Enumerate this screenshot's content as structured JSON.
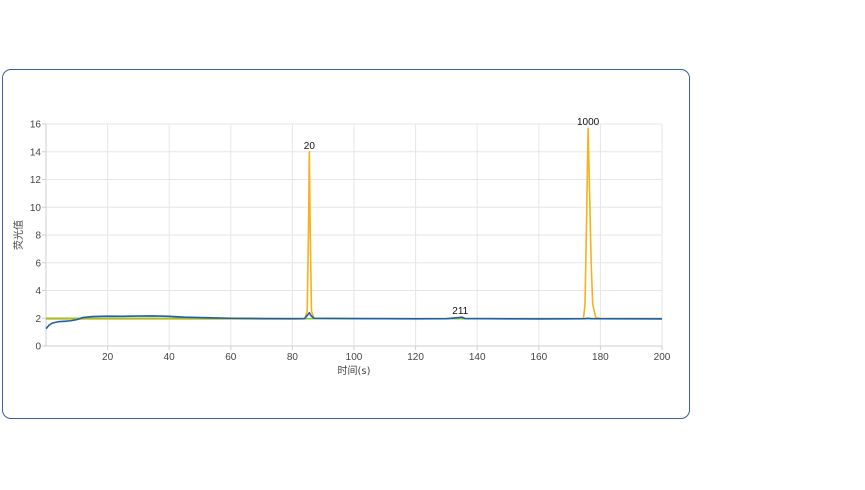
{
  "chart_data": {
    "type": "line",
    "xlabel": "时间(s)",
    "ylabel": "荧光值",
    "xlim": [
      0,
      200
    ],
    "ylim": [
      0,
      16
    ],
    "xticks": [
      20,
      40,
      60,
      80,
      100,
      120,
      140,
      160,
      180,
      200
    ],
    "yticks": [
      0,
      2,
      4,
      6,
      8,
      10,
      12,
      14,
      16
    ],
    "grid": true,
    "series": [
      {
        "color": "#f5b21c",
        "points": [
          [
            0,
            1.95
          ],
          [
            20,
            1.95
          ],
          [
            40,
            1.95
          ],
          [
            60,
            1.95
          ],
          [
            80,
            1.95
          ],
          [
            84,
            1.96
          ],
          [
            84.8,
            2.5
          ],
          [
            85.2,
            8.0
          ],
          [
            85.5,
            14.0
          ],
          [
            85.8,
            8.0
          ],
          [
            86.2,
            2.5
          ],
          [
            87,
            1.97
          ],
          [
            100,
            1.97
          ],
          [
            120,
            1.97
          ],
          [
            140,
            1.97
          ],
          [
            160,
            1.97
          ],
          [
            174.5,
            1.98
          ],
          [
            175,
            3.0
          ],
          [
            175.5,
            9.0
          ],
          [
            176,
            15.7
          ],
          [
            176.5,
            11.0
          ],
          [
            177,
            6.0
          ],
          [
            177.5,
            3.0
          ],
          [
            178.5,
            2.05
          ],
          [
            180,
            1.98
          ],
          [
            200,
            1.98
          ]
        ]
      },
      {
        "color": "#8cc63f",
        "points": [
          [
            0,
            2.0
          ],
          [
            10,
            2.0
          ],
          [
            20,
            2.0
          ],
          [
            40,
            2.0
          ],
          [
            60,
            1.98
          ],
          [
            80,
            1.97
          ],
          [
            100,
            1.97
          ],
          [
            120,
            1.97
          ],
          [
            140,
            1.97
          ],
          [
            160,
            1.97
          ],
          [
            180,
            1.97
          ],
          [
            200,
            1.97
          ]
        ]
      },
      {
        "color": "#1f5ea8",
        "points": [
          [
            0,
            1.25
          ],
          [
            1,
            1.5
          ],
          [
            2,
            1.65
          ],
          [
            4,
            1.75
          ],
          [
            6,
            1.78
          ],
          [
            8,
            1.82
          ],
          [
            10,
            1.9
          ],
          [
            12,
            2.05
          ],
          [
            15,
            2.12
          ],
          [
            20,
            2.15
          ],
          [
            25,
            2.14
          ],
          [
            30,
            2.16
          ],
          [
            35,
            2.17
          ],
          [
            40,
            2.14
          ],
          [
            45,
            2.08
          ],
          [
            50,
            2.05
          ],
          [
            55,
            2.02
          ],
          [
            60,
            2.0
          ],
          [
            70,
            1.98
          ],
          [
            80,
            1.97
          ],
          [
            84,
            1.98
          ],
          [
            85,
            2.25
          ],
          [
            85.5,
            2.4
          ],
          [
            86,
            2.2
          ],
          [
            87,
            2.0
          ],
          [
            100,
            1.98
          ],
          [
            110,
            1.97
          ],
          [
            120,
            1.96
          ],
          [
            130,
            1.97
          ],
          [
            134,
            2.05
          ],
          [
            135,
            2.08
          ],
          [
            136,
            1.98
          ],
          [
            150,
            1.96
          ],
          [
            160,
            1.95
          ],
          [
            170,
            1.96
          ],
          [
            175,
            1.97
          ],
          [
            176,
            2.0
          ],
          [
            177,
            1.97
          ],
          [
            190,
            1.96
          ],
          [
            200,
            1.95
          ]
        ]
      }
    ],
    "annotations": [
      {
        "text": "20",
        "x": 85.5,
        "y": 14.0
      },
      {
        "text": "211",
        "x": 134.5,
        "y": 2.1
      },
      {
        "text": "1000",
        "x": 176,
        "y": 15.7
      }
    ]
  }
}
